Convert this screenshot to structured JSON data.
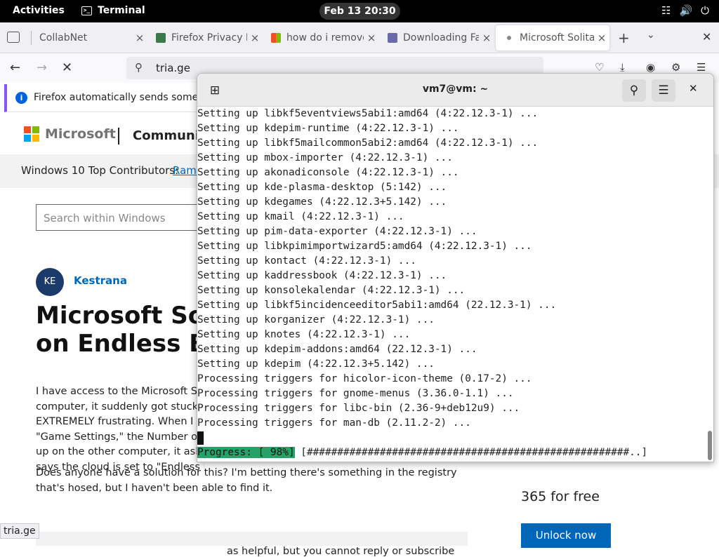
{
  "topbar": {
    "activities": "Activities",
    "app_name": "Terminal",
    "clock": "Feb 13  20:30"
  },
  "browser": {
    "tabs": [
      {
        "label": "CollabNet",
        "close": "×"
      },
      {
        "label": "Firefox Privacy N",
        "close": "×"
      },
      {
        "label": "how do i remove",
        "close": "×"
      },
      {
        "label": "Downloading Fa",
        "close": "×"
      },
      {
        "label": "Microsoft Solita",
        "close": "×"
      }
    ],
    "url": "tria.ge",
    "notification": "Firefox automatically sends some da",
    "status_url": "tria.ge"
  },
  "page": {
    "brand": "Microsoft",
    "community": "Community",
    "contributors_label": "Windows 10 Top Contributors:",
    "contributor_link": "Rame",
    "search_placeholder": "Search within Windows",
    "avatar_initials": "KE",
    "author": "Kestrana",
    "title_line1": "Microsoft Solit",
    "title_line2": "on Endless Boa",
    "body_lines": [
      "I have access to the Microsoft Solit",
      "computer, it suddenly got stuck on",
      "EXTREMELY frustrating.  When I go",
      "\"Game Settings,\" the Number of Bo",
      "up on the other computer, it asks w",
      "says the cloud is set to \"Endless Ra"
    ],
    "body_para2": "Does anyone have a solution for this?  I'm betting there's something in the registry that's hosed, but I haven't been able to find it.",
    "helpful_text": "as helpful, but you cannot reply or subscribe",
    "promo_text": "365 for free",
    "unlock_button": "Unlock now"
  },
  "terminal": {
    "title": "vm7@vm: ~",
    "lines": [
      "Setting up libkf5eventviews5abi1:amd64 (4:22.12.3-1) ...",
      "Setting up kdepim-runtime (4:22.12.3-1) ...",
      "Setting up libkf5mailcommon5abi2:amd64 (4:22.12.3-1) ...",
      "Setting up mbox-importer (4:22.12.3-1) ...",
      "Setting up akonadiconsole (4:22.12.3-1) ...",
      "Setting up kde-plasma-desktop (5:142) ...",
      "Setting up kdegames (4:22.12.3+5.142) ...",
      "Setting up kmail (4:22.12.3-1) ...",
      "Setting up pim-data-exporter (4:22.12.3-1) ...",
      "Setting up libkpimimportwizard5:amd64 (4:22.12.3-1) ...",
      "Setting up kontact (4:22.12.3-1) ...",
      "Setting up kaddressbook (4:22.12.3-1) ...",
      "Setting up konsolekalendar (4:22.12.3-1) ...",
      "Setting up libkf5incidenceeditor5abi1:amd64 (22.12.3-1) ...",
      "Setting up korganizer (4:22.12.3-1) ...",
      "Setting up knotes (4:22.12.3-1) ...",
      "Setting up kdepim-addons:amd64 (22.12.3-1) ...",
      "Setting up kdepim (4:22.12.3+5.142) ...",
      "Processing triggers for hicolor-icon-theme (0.17-2) ...",
      "Processing triggers for gnome-menus (3.36.0-1.1) ...",
      "Processing triggers for libc-bin (2.36-9+deb12u9) ...",
      "Processing triggers for man-db (2.11.2-2) ..."
    ],
    "progress_label": "Progress: [ 98%]",
    "progress_bar": " [#####################################################..]"
  },
  "colors": {
    "ms_red": "#f25022",
    "ms_green": "#7fba00",
    "ms_blue": "#00a4ef",
    "ms_yellow": "#ffb900",
    "link_blue": "#0067b8",
    "progress_green": "#26a269"
  }
}
